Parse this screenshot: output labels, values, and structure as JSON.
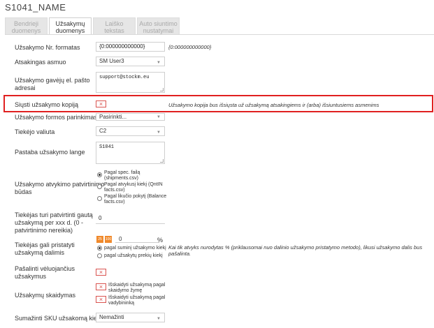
{
  "header": {
    "title": "S1041_NAME"
  },
  "tabs": [
    {
      "line1": "Bendrieji",
      "line2": "duomenys"
    },
    {
      "line1": "Užsakymų",
      "line2": "duomenys"
    },
    {
      "line1": "Laiško",
      "line2": "tekstas"
    },
    {
      "line1": "Auto siuntimo",
      "line2": "nustatymai"
    }
  ],
  "form": {
    "order_no_format": {
      "label": "Užsakymo Nr. formatas",
      "value": "{0:000000000000}",
      "hint": "{0:000000000000}"
    },
    "responsible": {
      "label": "Atsakingas asmuo",
      "value": "SM User3"
    },
    "receiver_email": {
      "label1": "Užsakymo gavėjų el. pašto",
      "label2": "adresai",
      "value": "support@stockm.eu"
    },
    "send_copy": {
      "label": "Siųsti užsakymo kopiją",
      "mark": "×",
      "note": "Užsakymo kopija bus išsiųsta už užsakymą atsakingiems ir (arba) išsiuntusiems asmenims"
    },
    "form_params": {
      "label": "Užsakymo formos parinkimas",
      "value": "Pasirinkti..."
    },
    "currency": {
      "label": "Tiekėjo valiuta",
      "value": "C2"
    },
    "order_note": {
      "label": "Pastaba užsakymo lange",
      "value": "S1041"
    },
    "confirm_method": {
      "label1": "Užsakymo atvykimo patvirtinimo",
      "label2": "būdas",
      "options": [
        {
          "l1": "Pagal spec. failą",
          "l2": "(shipments.csv)"
        },
        {
          "l1": "Pagal atvykusį kiekį (QntIN",
          "l2": "facts.csv)"
        },
        {
          "l1": "Pagal likučio pokytį (Balance",
          "l2": "facts.csv)"
        }
      ]
    },
    "confirm_days": {
      "l1": "Tiekėjas turi patvirtinti gautą",
      "l2": "užsakymą per xxx d. (0 -",
      "l3": "patvirtinimo nereikia)",
      "value": "0"
    },
    "partial_delivery": {
      "l1": "Tiekėjas gali pristatyti",
      "l2": "užsakymą dalimis",
      "chip1": "25",
      "chip2": "100",
      "value": "0",
      "unit": "%",
      "opt1": "pagal suminį užsakymo kiekį",
      "opt2": "pagal užsakytų prekių kiekį",
      "note": "Kai tik atvyks nurodytas % (priklausomai nuo dalinio užsakymo pristatymo metodo), likusi užsakymo dalis bus pašalinta."
    },
    "remove_late": {
      "l1": "Pašalinti vėluojančius",
      "l2": "užsakymus",
      "mark": "×"
    },
    "split": {
      "label": "Užsakymų skaidymas",
      "mark": "×",
      "opt1_l1": "Išskaidyti užsakymą pagal",
      "opt1_l2": "skaidymo žymę",
      "opt2_l1": "Išskaidyti užsakymą pagal",
      "opt2_l2": "vadybininką"
    },
    "reduce_sku": {
      "label": "Sumažinti SKU užsakomą kiekį",
      "value": "Nemažinti"
    }
  },
  "colors": {
    "highlight": "#e02020",
    "accent": "#f0892b",
    "check": "#d9534f"
  }
}
